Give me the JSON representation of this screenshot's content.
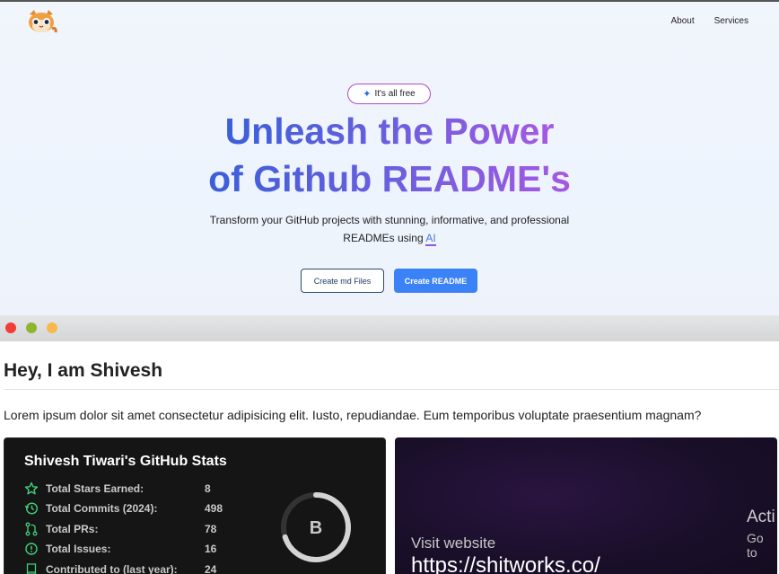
{
  "nav": {
    "items": [
      "About",
      "Services"
    ]
  },
  "hero": {
    "badge_icon": "sparkle-icon",
    "badge_text": "It's all free",
    "headline_line1": "Unleash the Power",
    "headline_line2": "of Github README's",
    "subtitle_line1": "Transform your GitHub projects with stunning, informative, and professional",
    "subtitle_line2_prefix": "READMEs using",
    "subtitle_highlight": "AI",
    "buttons": {
      "secondary": "Create md Files",
      "primary": "Create README"
    }
  },
  "window": {
    "controls": [
      "close",
      "minimize",
      "maximize"
    ]
  },
  "preview": {
    "greeting": "Hey, I am Shivesh",
    "description": "Lorem ipsum dolor sit amet consectetur adipisicing elit. Iusto, repudiandae. Eum temporibus voluptate praesentium magnam?",
    "stats": {
      "title": "Shivesh Tiwari's GitHub Stats",
      "rows": [
        {
          "icon": "star-icon",
          "label": "Total Stars Earned:",
          "value": "8"
        },
        {
          "icon": "history-icon",
          "label": "Total Commits (2024):",
          "value": "498"
        },
        {
          "icon": "pull-request-icon",
          "label": "Total PRs:",
          "value": "78"
        },
        {
          "icon": "issue-icon",
          "label": "Total Issues:",
          "value": "16"
        },
        {
          "icon": "book-icon",
          "label": "Contributed to (last year):",
          "value": "24"
        }
      ],
      "rank": "B",
      "rank_progress": 0.7
    },
    "promo": {
      "visit_label": "Visit website",
      "url": "https://shitworks.co/",
      "overlay_title": "Acti",
      "overlay_sub": "Go to"
    }
  },
  "colors": {
    "accent_blue": "#3b82f6",
    "stat_green": "#3fd07a",
    "badge_border": "#b04ac9"
  }
}
